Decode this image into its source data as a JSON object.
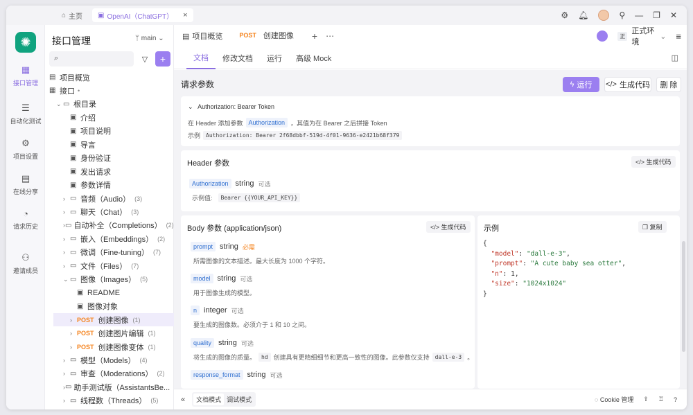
{
  "titlebar": {
    "home_tab": "主页",
    "active_tab": "OpenAI（ChatGPT）",
    "close": "×",
    "icons": [
      "gear-icon",
      "bell-icon",
      "pin-icon",
      "minimize-icon",
      "restore-icon",
      "close-icon"
    ],
    "win_minimize": "—",
    "win_restore": "❐",
    "win_close": "✕"
  },
  "rail": {
    "items": [
      {
        "label": "接口管理",
        "icon": "api-icon",
        "glyph": "▦"
      },
      {
        "label": "自动化测试",
        "icon": "stack-icon",
        "glyph": "☰"
      },
      {
        "label": "项目设置",
        "icon": "settings-icon",
        "glyph": "⚙"
      },
      {
        "label": "在线分享",
        "icon": "share-icon",
        "glyph": "▤"
      },
      {
        "label": "请求历史",
        "icon": "history-icon",
        "glyph": "◔"
      },
      {
        "label": "邀请成员",
        "icon": "invite-icon",
        "glyph": "⚇"
      }
    ]
  },
  "sidebar": {
    "title": "接口管理",
    "branch": "main",
    "search_placeholder": "",
    "tree": [
      {
        "label": "项目概览",
        "depth": 0,
        "icon": "overview-icon",
        "glyph": "▤",
        "chevron": ""
      },
      {
        "label": "接口",
        "depth": 0,
        "icon": "api-icon",
        "glyph": "▦",
        "chevron": "",
        "suffix": "•"
      },
      {
        "label": "根目录",
        "depth": 0,
        "icon": "folder-icon",
        "glyph": "▭",
        "chevron": "⌄"
      },
      {
        "label": "介绍",
        "depth": 1,
        "icon": "markdown-icon",
        "glyph": "▣",
        "chevron": ""
      },
      {
        "label": "项目说明",
        "depth": 1,
        "icon": "markdown-icon",
        "glyph": "▣",
        "chevron": ""
      },
      {
        "label": "导言",
        "depth": 1,
        "icon": "markdown-icon",
        "glyph": "▣",
        "chevron": ""
      },
      {
        "label": "身份验证",
        "depth": 1,
        "icon": "markdown-icon",
        "glyph": "▣",
        "chevron": ""
      },
      {
        "label": "发出请求",
        "depth": 1,
        "icon": "markdown-icon",
        "glyph": "▣",
        "chevron": ""
      },
      {
        "label": "参数详情",
        "depth": 1,
        "icon": "markdown-icon",
        "glyph": "▣",
        "chevron": ""
      },
      {
        "label": "音频（Audio）",
        "depth": 1,
        "icon": "folder-icon",
        "glyph": "▭",
        "chevron": "›",
        "count": "(3)"
      },
      {
        "label": "聊天（Chat）",
        "depth": 1,
        "icon": "folder-icon",
        "glyph": "▭",
        "chevron": "›",
        "count": "(3)"
      },
      {
        "label": "自动补全（Completions）",
        "depth": 1,
        "icon": "folder-icon",
        "glyph": "▭",
        "chevron": "›",
        "count": "(2)"
      },
      {
        "label": "嵌入（Embeddings）",
        "depth": 1,
        "icon": "folder-icon",
        "glyph": "▭",
        "chevron": "›",
        "count": "(2)"
      },
      {
        "label": "微调（Fine-tuning）",
        "depth": 1,
        "icon": "folder-icon",
        "glyph": "▭",
        "chevron": "›",
        "count": "(7)"
      },
      {
        "label": "文件（Files）",
        "depth": 1,
        "icon": "folder-icon",
        "glyph": "▭",
        "chevron": "›",
        "count": "(7)"
      },
      {
        "label": "图像（Images）",
        "depth": 1,
        "icon": "folder-icon",
        "glyph": "▭",
        "chevron": "⌄",
        "count": "(5)"
      },
      {
        "label": "README",
        "depth": 2,
        "icon": "markdown-icon",
        "glyph": "▣",
        "chevron": ""
      },
      {
        "label": "图像对象",
        "depth": 2,
        "icon": "markdown-icon",
        "glyph": "▣",
        "chevron": ""
      },
      {
        "label": "创建图像",
        "depth": 2,
        "method": "POST",
        "chevron": "›",
        "count": "(1)",
        "selected": true
      },
      {
        "label": "创建图片编辑",
        "depth": 2,
        "method": "POST",
        "chevron": "›",
        "count": "(1)"
      },
      {
        "label": "创建图像变体",
        "depth": 2,
        "method": "POST",
        "chevron": "›",
        "count": "(1)"
      },
      {
        "label": "模型（Models）",
        "depth": 1,
        "icon": "folder-icon",
        "glyph": "▭",
        "chevron": "›",
        "count": "(4)"
      },
      {
        "label": "审查（Moderations）",
        "depth": 1,
        "icon": "folder-icon",
        "glyph": "▭",
        "chevron": "›",
        "count": "(2)"
      },
      {
        "label": "助手测试版（AssistantsBe...",
        "depth": 1,
        "icon": "folder-icon",
        "glyph": "▭",
        "chevron": "›",
        "count": "(11)"
      },
      {
        "label": "线程数（Threads）",
        "depth": 1,
        "icon": "folder-icon",
        "glyph": "▭",
        "chevron": "›",
        "count": "(5)"
      }
    ]
  },
  "main": {
    "tabs": [
      {
        "label": "项目概览",
        "method": ""
      },
      {
        "label": "创建图像",
        "method": "POST"
      }
    ],
    "env_label": "正式环境",
    "env_badge": "正",
    "subtabs": [
      "文档",
      "修改文档",
      "运行",
      "高级 Mock"
    ],
    "active_subtab": 0
  },
  "request": {
    "title": "请求参数",
    "run_label": "运行",
    "gen_code_label": "生成代码",
    "delete_label": "删 除",
    "auth": {
      "title": "Authorization: Bearer Token",
      "line_pre": "在 Header 添加参数",
      "line_param": "Authorization",
      "line_post": "，其值为在 Bearer 之后拼接 Token",
      "example_label": "示例",
      "example_value": "Authorization: Bearer 2f68dbbf-519d-4f01-9636-e2421b68f379"
    },
    "header": {
      "title": "Header 参数",
      "gen_code": "生成代码",
      "param_name": "Authorization",
      "param_type": "string",
      "param_opt": "可选",
      "example_label": "示例值:",
      "example_value": "Bearer {{YOUR_API_KEY}}"
    },
    "body": {
      "title": "Body 参数 (application/json)",
      "gen_code": "生成代码",
      "params": [
        {
          "name": "prompt",
          "type": "string",
          "flag": "必需",
          "required": true,
          "desc": "所需图像的文本描述。最大长度为 1000 个字符。"
        },
        {
          "name": "model",
          "type": "string",
          "flag": "可选",
          "required": false,
          "desc": "用于图像生成的模型。"
        },
        {
          "name": "n",
          "type": "integer",
          "flag": "可选",
          "required": false,
          "desc": "要生成的图像数。必须介于 1 和 10 之间。"
        },
        {
          "name": "quality",
          "type": "string",
          "flag": "可选",
          "required": false,
          "desc_pre": "将生成的图像的质量。",
          "desc_code": "hd",
          "desc_mid": "创建具有更精细细节和更高一致性的图像。此参数仅支持",
          "desc_code2": "dall-e-3",
          "desc_post": "。"
        },
        {
          "name": "response_format",
          "type": "string",
          "flag": "可选",
          "required": false,
          "desc": ""
        }
      ]
    },
    "example": {
      "title": "示例",
      "copy_label": "复制",
      "json": [
        {
          "k": "\"model\"",
          "v": "\"dall-e-3\"",
          "num": false
        },
        {
          "k": "\"prompt\"",
          "v": "\"A cute baby sea otter\"",
          "num": false
        },
        {
          "k": "\"n\"",
          "v": "1",
          "num": true
        },
        {
          "k": "\"size\"",
          "v": "\"1024x1024\"",
          "num": false
        }
      ]
    }
  },
  "bottom": {
    "doc_mode": "文档模式",
    "debug_mode": "调试模式",
    "cookie": "Cookie 管理"
  }
}
